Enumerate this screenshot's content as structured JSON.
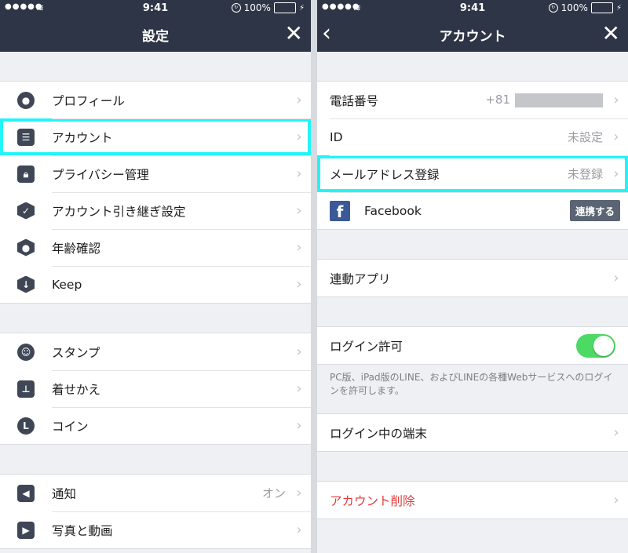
{
  "status": {
    "time": "9:41",
    "battery": "100%",
    "signal": "●●●●●",
    "wifi": "≋"
  },
  "left": {
    "title": "設定",
    "group1": [
      {
        "label": "プロフィール",
        "icon": "person-icon"
      },
      {
        "label": "アカウント",
        "icon": "id-card-icon"
      },
      {
        "label": "プライバシー管理",
        "icon": "lock-icon"
      },
      {
        "label": "アカウント引き継ぎ設定",
        "icon": "shield-check-icon"
      },
      {
        "label": "年齢確認",
        "icon": "shield-person-icon"
      },
      {
        "label": "Keep",
        "icon": "keep-icon"
      }
    ],
    "group2": [
      {
        "label": "スタンプ",
        "icon": "smiley-icon"
      },
      {
        "label": "着せかえ",
        "icon": "brush-icon"
      },
      {
        "label": "コイン",
        "icon": "coin-icon"
      }
    ],
    "group3": [
      {
        "label": "通知",
        "value": "オン",
        "icon": "speaker-icon"
      },
      {
        "label": "写真と動画",
        "icon": "media-icon"
      }
    ]
  },
  "right": {
    "title": "アカウント",
    "phone": {
      "label": "電話番号",
      "value": "+81"
    },
    "id": {
      "label": "ID",
      "value": "未設定"
    },
    "email": {
      "label": "メールアドレス登録",
      "value": "未登録"
    },
    "facebook": {
      "label": "Facebook",
      "button": "連携する"
    },
    "apps": {
      "label": "連動アプリ"
    },
    "login_allow": {
      "label": "ログイン許可",
      "note": "PC版、iPad版のLINE、およびLINEの各種Webサービスへのログインを許可します。"
    },
    "devices": {
      "label": "ログイン中の端末"
    },
    "delete": {
      "label": "アカウント削除"
    }
  },
  "colors": {
    "nav": "#2e3546",
    "highlight": "#22f4f8",
    "toggle": "#4cd964",
    "danger": "#e53a3a"
  }
}
